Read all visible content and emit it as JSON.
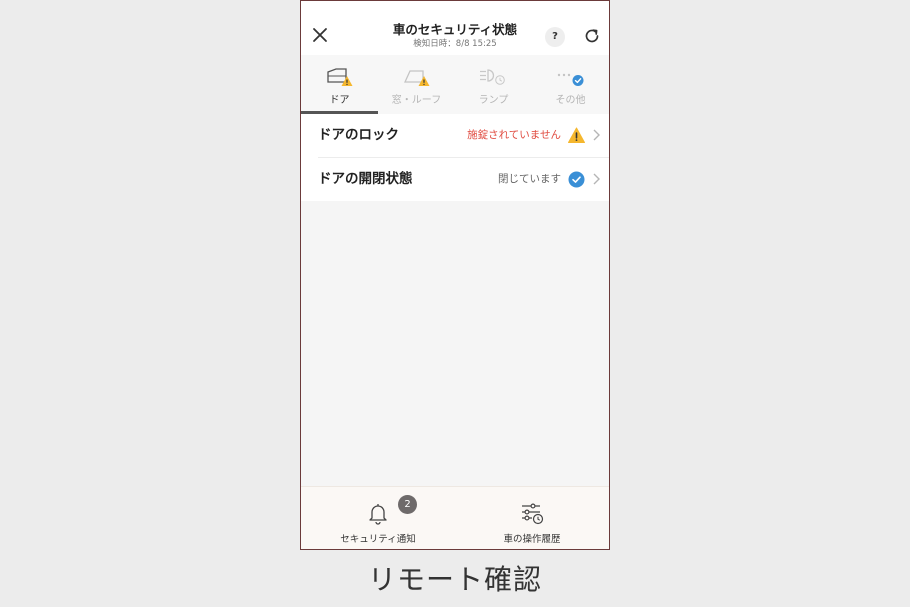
{
  "header": {
    "title": "車のセキュリティ状態",
    "subtitle": "検知日時：8/8 15:25",
    "help_label": "?"
  },
  "tabs": [
    {
      "label": "ドア",
      "icon": "door-warning-icon",
      "status": "warning",
      "active": true
    },
    {
      "label": "窓・ルーフ",
      "icon": "window-warning-icon",
      "status": "warning",
      "active": false
    },
    {
      "label": "ランプ",
      "icon": "lamp-icon",
      "status": "ok",
      "active": false
    },
    {
      "label": "その他",
      "icon": "more-check-icon",
      "status": "ok",
      "active": false
    }
  ],
  "rows": [
    {
      "label": "ドアのロック",
      "status_text": "施錠されていません",
      "status": "warning",
      "icon": "warning-icon"
    },
    {
      "label": "ドアの開閉状態",
      "status_text": "閉じています",
      "status": "ok",
      "icon": "check-circle-icon"
    }
  ],
  "bottom_bar": {
    "security_notification": {
      "label": "セキュリティ通知",
      "badge": "2",
      "icon": "bell-icon"
    },
    "operation_history": {
      "label": "車の操作履歴",
      "icon": "history-sliders-icon"
    }
  },
  "caption": "リモート確認",
  "colors": {
    "warning_yellow": "#f5b72e",
    "warning_text": "#e04a3f",
    "ok_blue": "#3a8fd6",
    "badge_gray": "#6e6a6a"
  }
}
